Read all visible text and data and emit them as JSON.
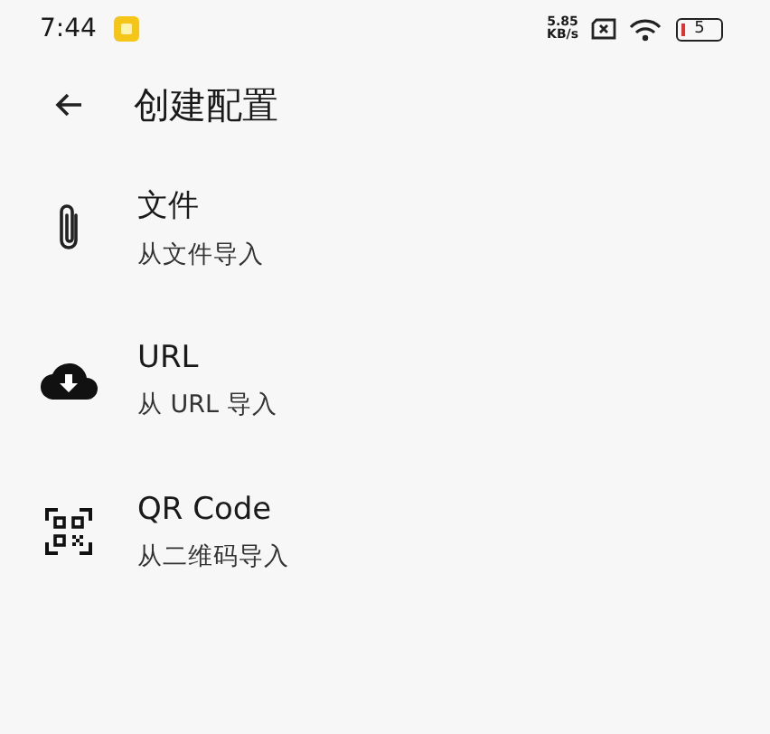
{
  "status_bar": {
    "time": "7:44",
    "speed_value": "5.85",
    "speed_unit": "KB/s",
    "battery": "5"
  },
  "header": {
    "title": "创建配置"
  },
  "items": [
    {
      "kind": "file",
      "title": "文件",
      "subtitle": "从文件导入"
    },
    {
      "kind": "url",
      "title": "URL",
      "subtitle": "从 URL 导入"
    },
    {
      "kind": "qr",
      "title": "QR Code",
      "subtitle": "从二维码导入"
    }
  ]
}
